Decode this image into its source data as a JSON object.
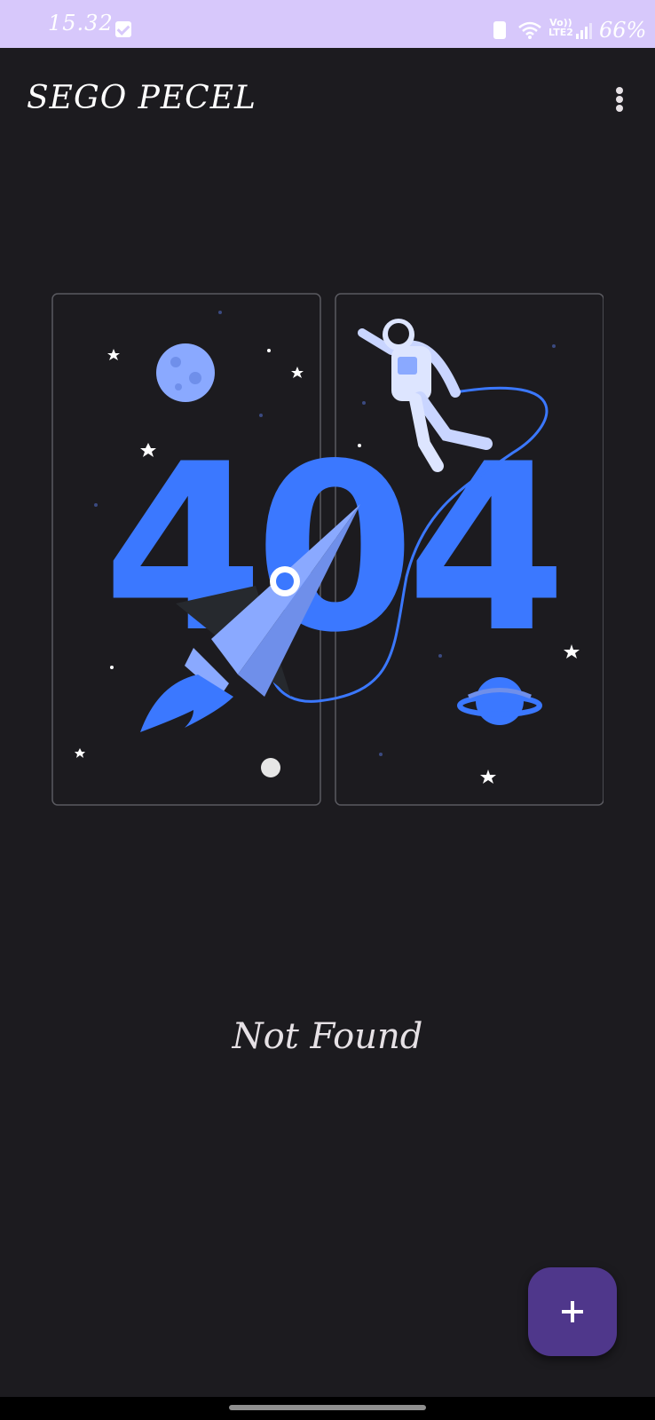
{
  "status_bar": {
    "time": "15.32",
    "network_label_top": "Vo))",
    "network_label_bottom": "LTE2",
    "battery": "66%"
  },
  "app_bar": {
    "title": "SEGO PECEL",
    "menu_icon": "more-vert-icon"
  },
  "illustration": {
    "big_text": "404",
    "accent": "#3b78ff",
    "light_blue": "#8aa9ff"
  },
  "message": {
    "text": "Not Found"
  },
  "fab": {
    "icon": "plus-icon",
    "color": "#4f378b"
  }
}
